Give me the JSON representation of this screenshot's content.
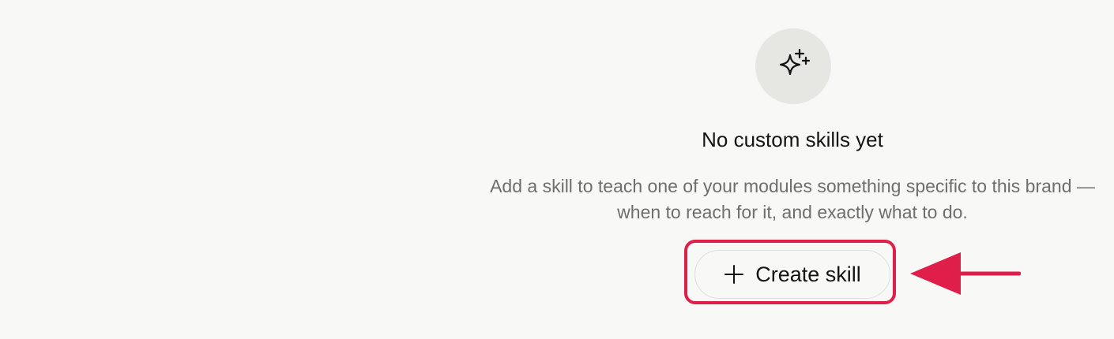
{
  "empty_state": {
    "icon": "sparkle-icon",
    "title": "No custom skills yet",
    "description": "Add a skill to teach one of your modules something specific to this brand — when to reach for it, and exactly what to do."
  },
  "create_button": {
    "icon": "plus-icon",
    "label": "Create skill"
  },
  "annotation": {
    "highlight_color": "#e01e4a",
    "arrow_color": "#e01e4a"
  }
}
